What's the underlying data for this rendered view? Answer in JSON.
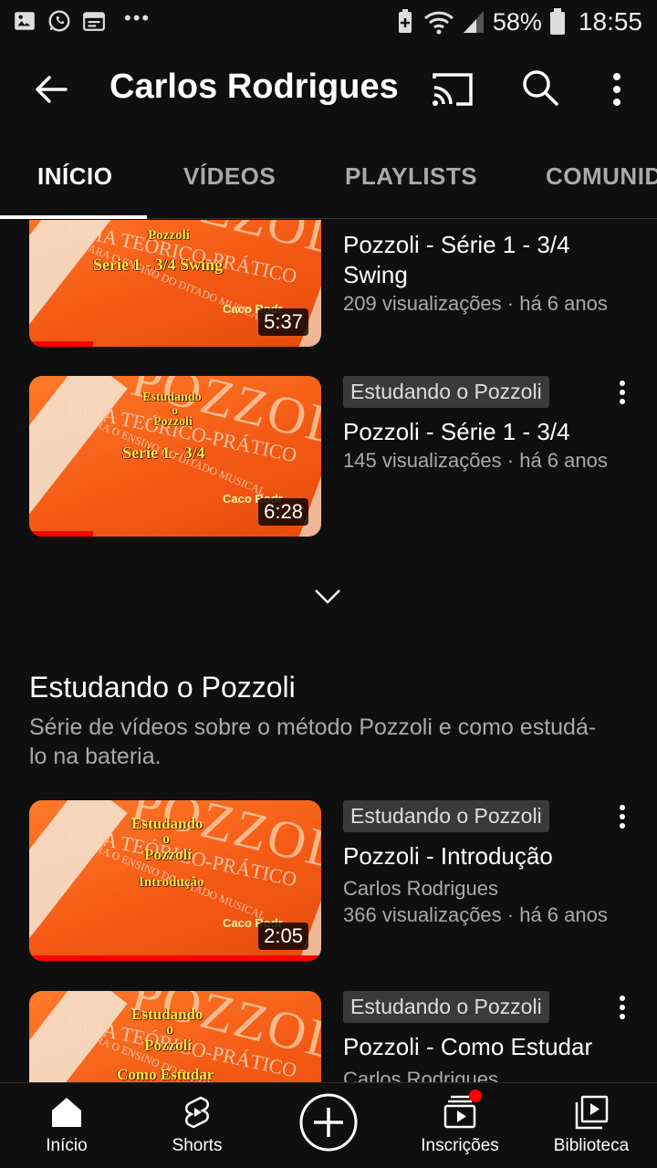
{
  "status_bar": {
    "battery": "58%",
    "time": "18:55",
    "icons": [
      "gallery-icon",
      "whatsapp-icon",
      "calendar-icon",
      "more-dots-icon",
      "battery-saver-icon",
      "wifi-icon",
      "signal-icon",
      "battery-icon"
    ],
    "dots": "•••"
  },
  "appbar": {
    "title": "Carlos Rodrigues"
  },
  "tabs": [
    {
      "label": "INÍCIO",
      "active": true
    },
    {
      "label": "VÍDEOS",
      "active": false
    },
    {
      "label": "PLAYLISTS",
      "active": false
    },
    {
      "label": "COMUNID",
      "active": false
    }
  ],
  "videos": [
    {
      "title": "Pozzoli - Série 1 - 3/4 Swing",
      "meta": "209 visualizações · há 6 anos",
      "duration": "5:37",
      "thumb_lines": [
        "Pozzoli",
        "Serie 1 - 3/4 Swing"
      ],
      "progress": 0.22
    },
    {
      "badge": "Estudando o Pozzoli",
      "title": "Pozzoli - Série 1 - 3/4",
      "meta": "145 visualizações · há 6 anos",
      "duration": "6:28",
      "thumb_lines": [
        "Estudando",
        "o",
        "Pozzoli",
        "Serie 1 - 3/4"
      ],
      "progress": 0.22
    }
  ],
  "section": {
    "title": "Estudando o Pozzoli",
    "description": "Série de vídeos sobre o método Pozzoli e como estudá-lo na bateria."
  },
  "section_videos": [
    {
      "badge": "Estudando o Pozzoli",
      "title": "Pozzoli - Introdução",
      "channel": "Carlos Rodrigues",
      "meta": "366 visualizações · há 6 anos",
      "duration": "2:05",
      "thumb_lines": [
        "Estudando",
        "o",
        "Pozzoli",
        "Introdução"
      ],
      "progress": 1.0
    },
    {
      "badge": "Estudando o Pozzoli",
      "title": "Pozzoli - Como Estudar",
      "channel": "Carlos Rodrigues",
      "thumb_lines": [
        "Estudando",
        "o",
        "Pozzoli",
        "Como Estudar"
      ]
    }
  ],
  "thumb_common": {
    "big_word": "POZZOLI",
    "guia": "GUIA TEÓRICO-PRÁTICO",
    "para": "PARA O ENSINO DO DITADO MUSICAL",
    "caco": "Caco Rodr"
  },
  "bottom_nav": [
    {
      "label": "Início",
      "icon": "home-icon"
    },
    {
      "label": "Shorts",
      "icon": "shorts-icon"
    },
    {
      "label": "",
      "icon": "create-icon"
    },
    {
      "label": "Inscrições",
      "icon": "subscriptions-icon"
    },
    {
      "label": "Biblioteca",
      "icon": "library-icon"
    }
  ],
  "colors": {
    "background": "#0f0f0f",
    "accent": "#ff0000",
    "thumb_orange": "#f45a14",
    "secondary_text": "#aaaaaa"
  }
}
